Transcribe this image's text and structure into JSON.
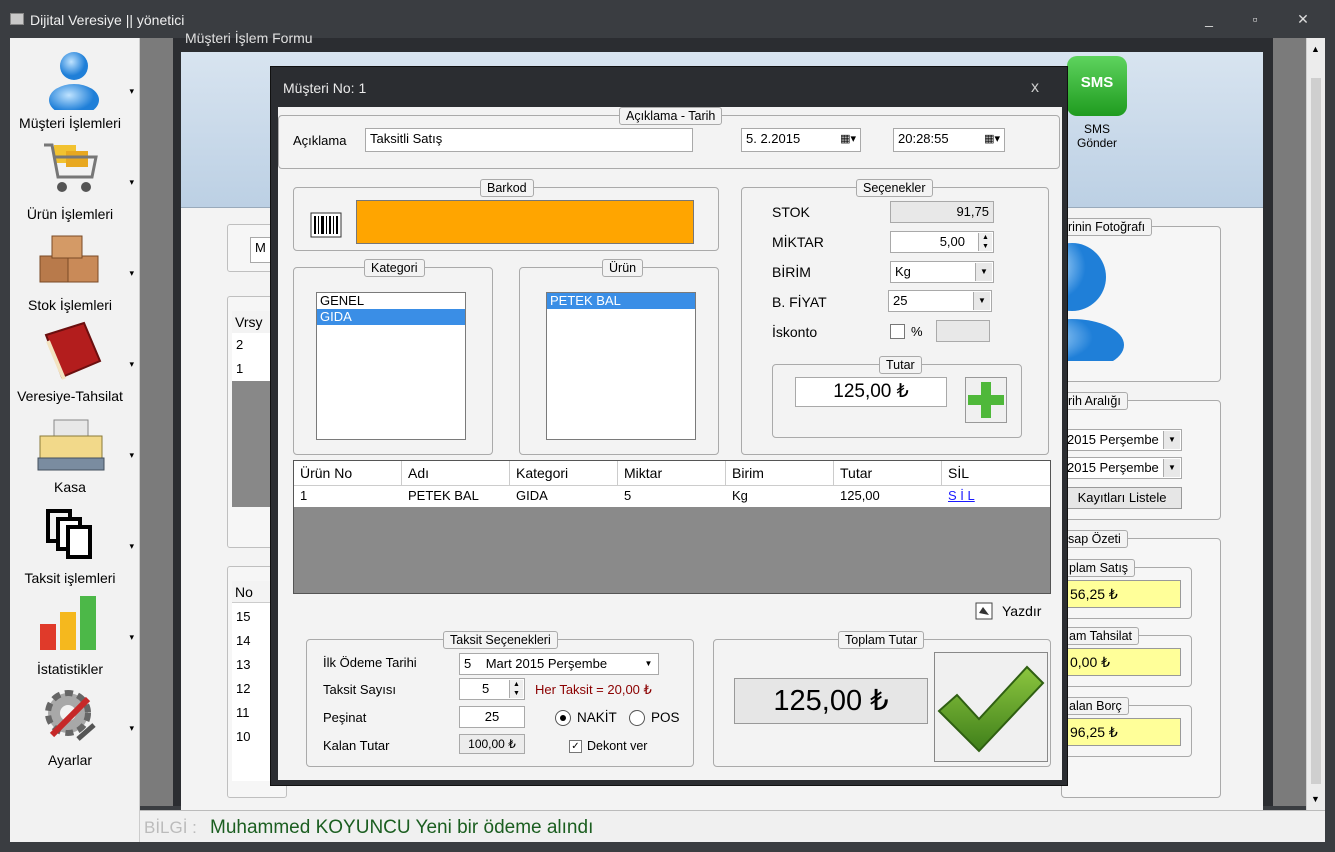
{
  "window": {
    "title": "Dijital Veresiye  ||  yönetici",
    "minimize": "_",
    "maximize": "▫",
    "close": "✕"
  },
  "sidebar": {
    "items": [
      {
        "label": "Müşteri İşlemleri",
        "icon": "user-icon"
      },
      {
        "label": "Ürün İşlemleri",
        "icon": "shopping-cart-icon"
      },
      {
        "label": "Stok İşlemleri",
        "icon": "boxes-icon"
      },
      {
        "label": "Veresiye-Tahsilat",
        "icon": "book-icon"
      },
      {
        "label": "Kasa",
        "icon": "cash-register-icon"
      },
      {
        "label": "Taksit işlemleri",
        "icon": "documents-icon"
      },
      {
        "label": "İstatistikler",
        "icon": "bar-chart-icon"
      },
      {
        "label": "Ayarlar",
        "icon": "gear-icon"
      }
    ]
  },
  "background_form": {
    "title": "Müşteri İşlem Formu",
    "sms_label": "SMS",
    "sms_caption_1": "SMS",
    "sms_caption_2": "Gönder",
    "search_partial": "M",
    "version_table": {
      "header": "Vrsy",
      "rows": [
        "2",
        "1"
      ]
    },
    "no_table": {
      "header": "No",
      "rows": [
        "15",
        "14",
        "13",
        "12",
        "11",
        "10"
      ]
    },
    "photo_group": "rinin Fotoğrafı",
    "date_range_group": "rih Aralığı",
    "date_range_1": "2015 Perşembe",
    "date_range_2": "2015 Perşembe",
    "list_button": "Kayıtları Listele",
    "summary_group": "sap Özeti",
    "total_sales_label": "plam Satış",
    "total_sales_value": "56,25 ₺",
    "total_collection_label": "am Tahsilat",
    "total_collection_value": "0,00 ₺",
    "remaining_debt_label": "alan Borç",
    "remaining_debt_value": "96,25 ₺"
  },
  "dialog": {
    "title": "Müşteri No: 1",
    "close": "x",
    "description_group": "Açıklama - Tarih",
    "description_label": "Açıklama",
    "description_value": "Taksitli Satış",
    "date_value": "5.  2.2015",
    "time_value": "20:28:55",
    "barcode_group": "Barkod",
    "category_group": "Kategori",
    "categories": [
      "GENEL",
      "GIDA"
    ],
    "selected_category": "GIDA",
    "product_group": "Ürün",
    "products": [
      "PETEK BAL"
    ],
    "options_group": "Seçenekler",
    "stock_label": "STOK",
    "stock_value": "91,75",
    "quantity_label": "MİKTAR",
    "quantity_value": "5,00",
    "unit_label": "BİRİM",
    "unit_value": "Kg",
    "price_label": "B. FİYAT",
    "price_value": "25",
    "discount_label": "İskonto",
    "discount_percent": "%",
    "amount_group": "Tutar",
    "amount_value": "125,00 ₺",
    "table": {
      "headers": [
        "Ürün No",
        "Adı",
        "Kategori",
        "Miktar",
        "Birim",
        "Tutar",
        "SİL"
      ],
      "rows": [
        [
          "1",
          "PETEK BAL",
          "GIDA",
          "5",
          "Kg",
          "125,00",
          "S İ L"
        ]
      ]
    },
    "print_label": "Yazdır",
    "installment_group": "Taksit Seçenekleri",
    "first_payment_label": "İlk Ödeme Tarihi",
    "first_payment_day": "5",
    "first_payment_rest": "Mart   2015 Perşembe",
    "installment_count_label": "Taksit Sayısı",
    "installment_count_value": "5",
    "per_installment": "Her Taksit = 20,00 ₺",
    "down_payment_label": "Peşinat",
    "down_payment_value": "25",
    "cash_label": "NAKİT",
    "pos_label": "POS",
    "remaining_label": "Kalan Tutar",
    "remaining_value": "100,00 ₺",
    "receipt_label": "Dekont ver",
    "total_group": "Toplam Tutar",
    "total_value": "125,00 ₺"
  },
  "status": {
    "prefix": "BİLGİ :",
    "text": "Muhammed KOYUNCU Yeni bir ödeme alındı"
  },
  "colors": {
    "barcode": "#ffa500",
    "accent": "#3a8ee6",
    "confirm": "#4a8a1e",
    "highlight": "#ffff99"
  }
}
